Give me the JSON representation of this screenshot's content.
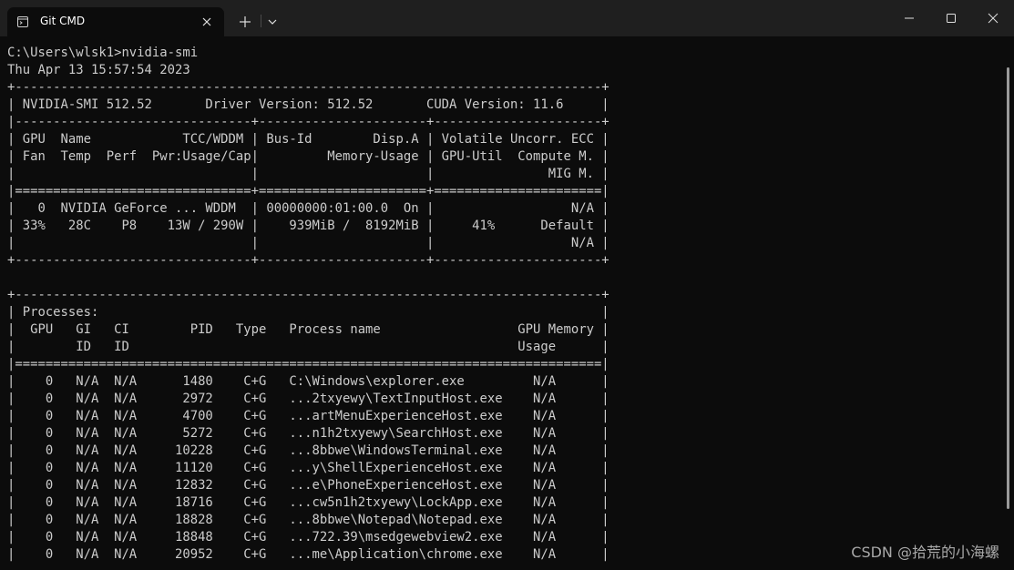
{
  "tab": {
    "title": "Git CMD",
    "icon": "terminal-icon"
  },
  "titlebar": {
    "new_tab_icon": "plus-icon",
    "dropdown_icon": "chevron-down-icon",
    "minimize_icon": "minimize-icon",
    "maximize_icon": "maximize-icon",
    "close_icon": "close-icon"
  },
  "terminal": {
    "lines": [
      "C:\\Users\\wlsk1>nvidia-smi",
      "Thu Apr 13 15:57:54 2023",
      "+-----------------------------------------------------------------------------+",
      "| NVIDIA-SMI 512.52       Driver Version: 512.52       CUDA Version: 11.6     |",
      "|-------------------------------+----------------------+----------------------+",
      "| GPU  Name            TCC/WDDM | Bus-Id        Disp.A | Volatile Uncorr. ECC |",
      "| Fan  Temp  Perf  Pwr:Usage/Cap|         Memory-Usage | GPU-Util  Compute M. |",
      "|                               |                      |               MIG M. |",
      "|===============================+======================+======================|",
      "|   0  NVIDIA GeForce ... WDDM  | 00000000:01:00.0  On |                  N/A |",
      "| 33%   28C    P8    13W / 290W |    939MiB /  8192MiB |     41%      Default |",
      "|                               |                      |                  N/A |",
      "+-------------------------------+----------------------+----------------------+",
      "",
      "+-----------------------------------------------------------------------------+",
      "| Processes:                                                                  |",
      "|  GPU   GI   CI        PID   Type   Process name                  GPU Memory |",
      "|        ID   ID                                                   Usage      |",
      "|=============================================================================|",
      "|    0   N/A  N/A      1480    C+G   C:\\Windows\\explorer.exe         N/A      |",
      "|    0   N/A  N/A      2972    C+G   ...2txyewy\\TextInputHost.exe    N/A      |",
      "|    0   N/A  N/A      4700    C+G   ...artMenuExperienceHost.exe    N/A      |",
      "|    0   N/A  N/A      5272    C+G   ...n1h2txyewy\\SearchHost.exe    N/A      |",
      "|    0   N/A  N/A     10228    C+G   ...8bbwe\\WindowsTerminal.exe    N/A      |",
      "|    0   N/A  N/A     11120    C+G   ...y\\ShellExperienceHost.exe    N/A      |",
      "|    0   N/A  N/A     12832    C+G   ...e\\PhoneExperienceHost.exe    N/A      |",
      "|    0   N/A  N/A     18716    C+G   ...cw5n1h2txyewy\\LockApp.exe    N/A      |",
      "|    0   N/A  N/A     18828    C+G   ...8bbwe\\Notepad\\Notepad.exe    N/A      |",
      "|    0   N/A  N/A     18848    C+G   ...722.39\\msedgewebview2.exe    N/A      |",
      "|    0   N/A  N/A     20952    C+G   ...me\\Application\\chrome.exe    N/A      |"
    ]
  },
  "watermark": "CSDN @拾荒的小海螺"
}
